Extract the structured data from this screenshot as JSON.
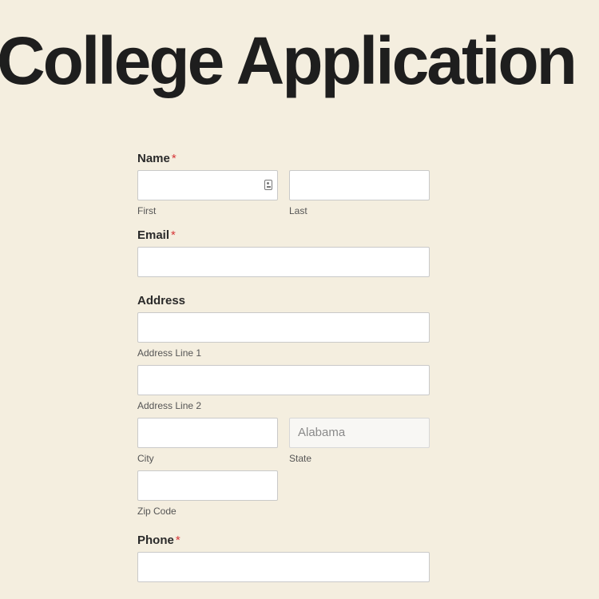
{
  "page": {
    "title": "College Application"
  },
  "form": {
    "name": {
      "label": "Name",
      "required_mark": "*",
      "first_sublabel": "First",
      "last_sublabel": "Last"
    },
    "email": {
      "label": "Email",
      "required_mark": "*"
    },
    "address": {
      "label": "Address",
      "line1_sublabel": "Address Line 1",
      "line2_sublabel": "Address Line 2",
      "city_sublabel": "City",
      "state_sublabel": "State",
      "state_value": "Alabama",
      "zip_sublabel": "Zip Code"
    },
    "phone": {
      "label": "Phone",
      "required_mark": "*"
    }
  },
  "colors": {
    "background": "#f4eedf",
    "required": "#d63638",
    "title": "#1e1e1e"
  },
  "icons": {
    "contact_card": "contact-card-icon"
  }
}
